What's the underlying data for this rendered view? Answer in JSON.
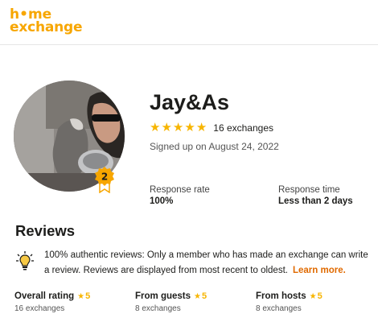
{
  "brand": {
    "logo_line1": "h•me",
    "logo_line2": "exchange",
    "accent": "#f7a600"
  },
  "profile": {
    "name": "Jay&As",
    "stars": [
      "★",
      "★",
      "★",
      "★",
      "★"
    ],
    "exchanges": "16 exchanges",
    "signed_up": "Signed up on August 24, 2022",
    "badge_level": "2"
  },
  "stats": {
    "response_rate_label": "Response rate",
    "response_rate_value": "100%",
    "response_time_label": "Response time",
    "response_time_value": "Less than 2 days"
  },
  "reviews": {
    "title": "Reviews",
    "info_text": "100% authentic reviews: Only a member who has made an exchange can write a review. Reviews are displayed from most recent to oldest.",
    "learn_more": "Learn more.",
    "ratings": [
      {
        "label": "Overall rating",
        "star": "★",
        "score": "5",
        "count": "16 exchanges"
      },
      {
        "label": "From guests",
        "star": "★",
        "score": "5",
        "count": "8 exchanges"
      },
      {
        "label": "From hosts",
        "star": "★",
        "score": "5",
        "count": "8 exchanges"
      }
    ]
  }
}
